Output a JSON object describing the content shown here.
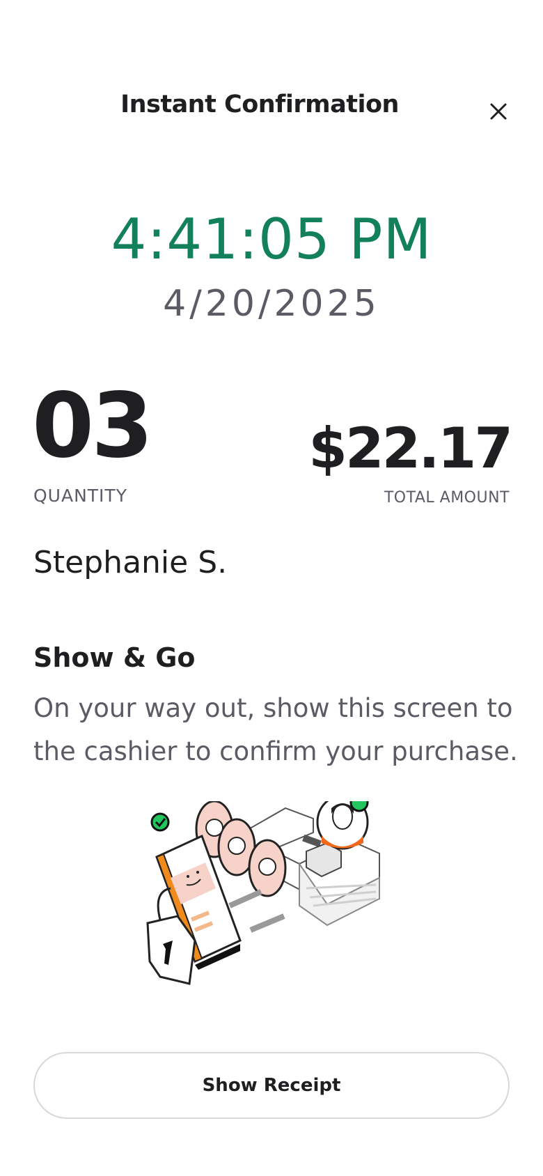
{
  "header": {
    "title": "Instant Confirmation",
    "close_icon": "close-icon"
  },
  "confirmation": {
    "time": "4:41:05 PM",
    "date": "4/20/2025",
    "time_color": "#12805b"
  },
  "summary": {
    "quantity_value": "03",
    "quantity_label": "QUANTITY",
    "amount_value": "$22.17",
    "amount_label": "TOTAL AMOUNT"
  },
  "customer": {
    "name": "Stephanie S."
  },
  "instructions": {
    "title": "Show & Go",
    "body": "On your way out, show this screen to the cashier to confirm your purchase."
  },
  "illustration": {
    "icon": "checkout-illustration",
    "accent_colors": [
      "#f08a1c",
      "#22c55e",
      "#f7d2c9"
    ]
  },
  "actions": {
    "show_receipt_label": "Show Receipt"
  }
}
